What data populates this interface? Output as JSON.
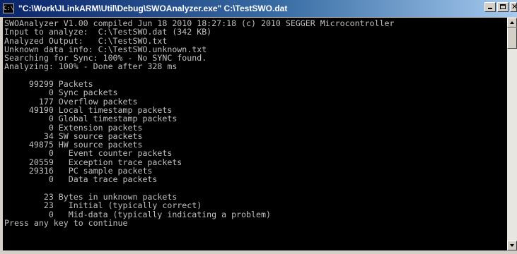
{
  "window": {
    "title": "\"C:\\Work\\JLinkARM\\Util\\Debug\\SWOAnalyzer.exe\" C:\\TestSWO.dat",
    "icon_glyph": "C:\\",
    "icon": "console-app-icon",
    "buttons": {
      "minimize": "minimize-icon",
      "maximize": "maximize-icon",
      "close": "close-icon"
    }
  },
  "console": {
    "colors": {
      "background": "#000000",
      "text": "#c0c0c0"
    },
    "lines": [
      "SWOAnalyzer V1.00 compiled Jun 18 2010 18:27:18 (c) 2010 SEGGER Microcontroller",
      "Input to analyze:  C:\\TestSWO.dat (342 KB)",
      "Analyzed Output:   C:\\TestSWO.txt",
      "Unknown data info: C:\\TestSWO.unknown.txt",
      "Searching for Sync: 100% - No SYNC found.",
      "Analyzing: 100% - Done after 328 ms",
      "",
      "     99299 Packets",
      "         0 Sync packets",
      "       177 Overflow packets",
      "     49190 Local timestamp packets",
      "         0 Global timestamp packets",
      "         0 Extension packets",
      "        34 SW source packets",
      "     49875 HW source packets",
      "         0   Event counter packets",
      "     20559   Exception trace packets",
      "     29316   PC sample packets",
      "         0   Data trace packets",
      "",
      "        23 Bytes in unknown packets",
      "        23   Initial (typically correct)",
      "         0   Mid-data (typically indicating a problem)",
      "Press any key to continue"
    ]
  }
}
